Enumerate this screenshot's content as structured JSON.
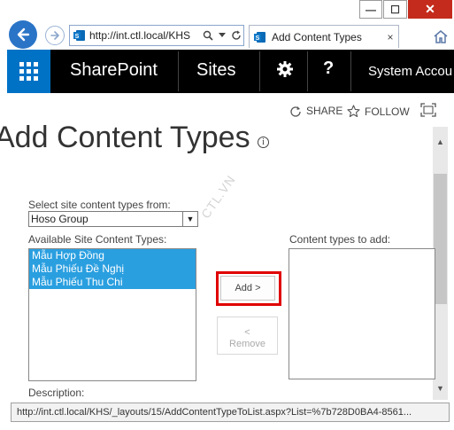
{
  "window": {
    "minimize": "—",
    "maximize": "☐",
    "close": "✕"
  },
  "browser": {
    "address_url": "http://int.ctl.local/KHS",
    "tab_title": "Add Content Types",
    "tab_close": "×"
  },
  "suitebar": {
    "brand": "SharePoint",
    "sites": "Sites",
    "help": "?",
    "account": "System Accou"
  },
  "actions": {
    "share": "SHARE",
    "follow": "FOLLOW"
  },
  "page": {
    "title": "Add Content Types",
    "info": "i"
  },
  "form": {
    "select_from_label": "Select site content types from:",
    "select_value": "Hoso Group",
    "available_label": "Available Site Content Types:",
    "available_items": [
      "Mẫu Hợp Đồng",
      "Mẫu Phiếu Đề Nghị",
      "Mẫu Phiếu Thu Chi"
    ],
    "to_add_label": "Content types to add:",
    "add_button": "Add >",
    "remove_button_arrow": "<",
    "remove_button": "Remove",
    "description_label": "Description:"
  },
  "watermark": "CTL.VN",
  "status_url": "http://int.ctl.local/KHS/_layouts/15/AddContentTypeToList.aspx?List=%7b728D0BA4-8561...",
  "colors": {
    "suite_bar": "#000000",
    "waffle": "#0072c6",
    "selection": "#2a9fe0",
    "highlight": "#e00000"
  }
}
